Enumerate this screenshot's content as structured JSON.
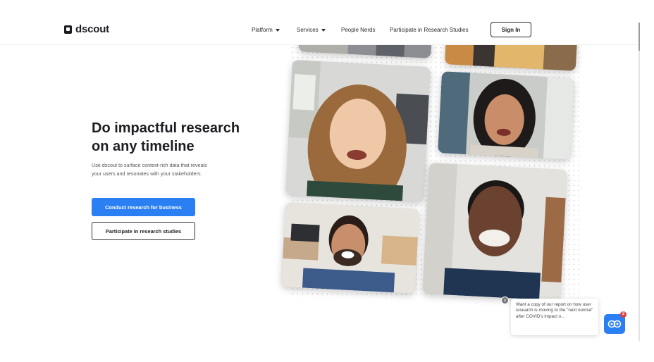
{
  "brand": {
    "name": "dscout",
    "logo_icon": "dscout-logo-icon"
  },
  "nav": {
    "items": [
      {
        "label": "Platform",
        "has_dropdown": true
      },
      {
        "label": "Services",
        "has_dropdown": true
      },
      {
        "label": "People Nerds",
        "has_dropdown": false
      },
      {
        "label": "Participate in Research Studies",
        "has_dropdown": false
      }
    ],
    "sign_in": "Sign In"
  },
  "hero": {
    "title_line1": "Do impactful research",
    "title_line2": "on any timeline",
    "body": "Use dscout to surface context-rich data that reveals your users and resonates with your stakeholders",
    "cta_primary": "Conduct research for business",
    "cta_secondary": "Participate in research studies"
  },
  "colors": {
    "accent": "#2a7ff3",
    "text": "#1c1d22",
    "badge": "#e23b3b"
  },
  "chat": {
    "message": "Want a copy of our report on how user research is moving to the \"next normal\" after COVID's impact o...",
    "badge_count": "2",
    "launcher_icon": "chat-bot-icon",
    "close_icon": "close-icon"
  }
}
